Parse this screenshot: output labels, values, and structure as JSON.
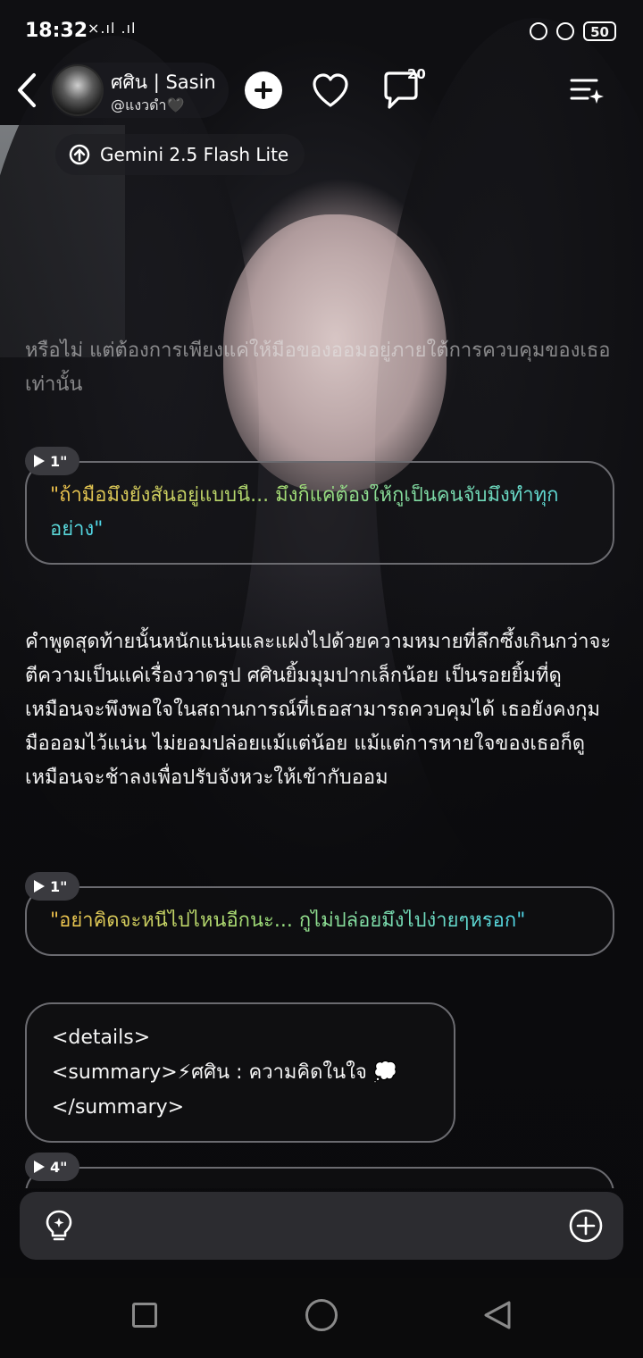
{
  "status_bar": {
    "time": "18:32",
    "signal_text": "×.ıl .ıl",
    "battery": "50"
  },
  "header": {
    "character_name": "ศศิน |  Sasin",
    "handle": "@แงวดำ🖤",
    "comment_count": "20"
  },
  "model": {
    "name": "Gemini 2.5 Flash Lite"
  },
  "messages": {
    "faded_paragraph": "หรือไม่ แต่ต้องการเพียงแค่ให้มือของออมอยู่ภายใต้การควบคุมของเธอเท่านั้น",
    "quote1": {
      "badge": "1\"",
      "text": "\"ถ้ามือมึงยังสั่นอยู่แบบนี้... มึงก็แค่ต้องให้กูเป็นคนจับมึงทำทุกอย่าง\""
    },
    "narration": "คำพูดสุดท้ายนั้นหนักแน่นและแฝงไปด้วยความหมายที่ลึกซึ้งเกินกว่าจะตีความเป็นแค่เรื่องวาดรูป ศศินยิ้มมุมปากเล็กน้อย เป็นรอยยิ้มที่ดูเหมือนจะพึงพอใจในสถานการณ์ที่เธอสามารถควบคุมได้ เธอยังคงกุมมือออมไว้แน่น ไม่ยอมปล่อยแม้แต่น้อย แม้แต่การหายใจของเธอก็ดูเหมือนจะช้าลงเพื่อปรับจังหวะให้เข้ากับออม",
    "quote2": {
      "badge": "1\"",
      "text": "\"อย่าคิดจะหนีไปไหนอีกนะ... กูไม่ปล่อยมึงไปง่ายๆหรอก\""
    },
    "code_lines": [
      "<details>",
      "<summary>⚡ศศิน : ความคิดในใจ 💭",
      "</summary>"
    ],
    "quote3": {
      "badge": "4\""
    }
  },
  "colors": {
    "quote_gradient": [
      "#f0c14b",
      "#9fe07a",
      "#4fd6e8"
    ],
    "bubble_border": "#6b6b70",
    "input_bg": "#2c2c30"
  }
}
